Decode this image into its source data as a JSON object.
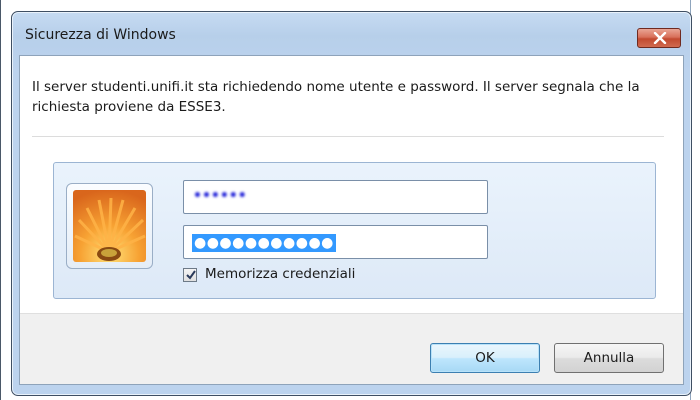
{
  "window": {
    "title": "Sicurezza di Windows",
    "close_icon": "close-icon"
  },
  "message": "Il server studenti.unifi.it sta richiedendo nome utente e password. Il server segnala che la richiesta proviene da ESSE3.",
  "credentials": {
    "avatar_icon": "flower-avatar-icon",
    "username_value": "••••••",
    "password_value": "●●●●●●●●●●●",
    "remember": {
      "label": "Memorizza credenziali",
      "checked": true
    }
  },
  "buttons": {
    "ok_label": "OK",
    "cancel_label": "Annulla"
  },
  "colors": {
    "selection": "#3399ff",
    "close_button": "#c24a30",
    "username_scribble": "#2121d8"
  }
}
